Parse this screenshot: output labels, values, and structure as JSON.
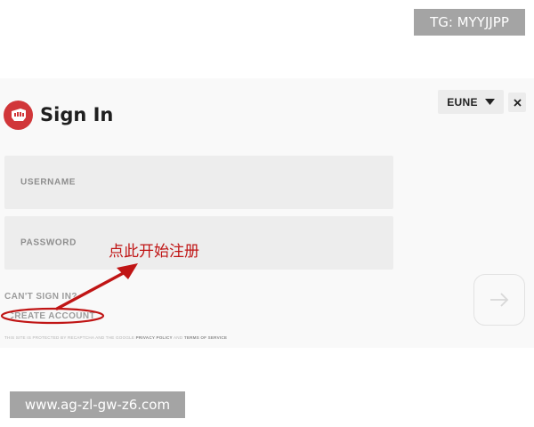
{
  "watermarks": {
    "top": "TG: MYYJJPP",
    "bottom": "www.ag-zl-gw-z6.com"
  },
  "login": {
    "title": "Sign In",
    "region": "EUNE",
    "username_placeholder": "USERNAME",
    "password_placeholder": "PASSWORD",
    "cant_sign_in": "CAN'T SIGN IN?",
    "create_account": "CREATE ACCOUNT",
    "fine_print": {
      "lead": "THIS SITE IS PROTECTED BY RECAPTCHA AND THE GOOGLE ",
      "privacy": "PRIVACY POLICY",
      "and": " AND ",
      "terms": "TERMS OF SERVICE"
    }
  },
  "annotation": {
    "text": "点此开始注册",
    "color": "#c01515"
  },
  "icons": {
    "logo": "riot-fist-logo",
    "region_caret": "caret-down-icon",
    "close": "close-icon",
    "submit": "arrow-right-icon"
  },
  "colors": {
    "brand": "#d13639",
    "annotation": "#c01515",
    "panel": "#f9f9f9",
    "field": "#ededed"
  }
}
